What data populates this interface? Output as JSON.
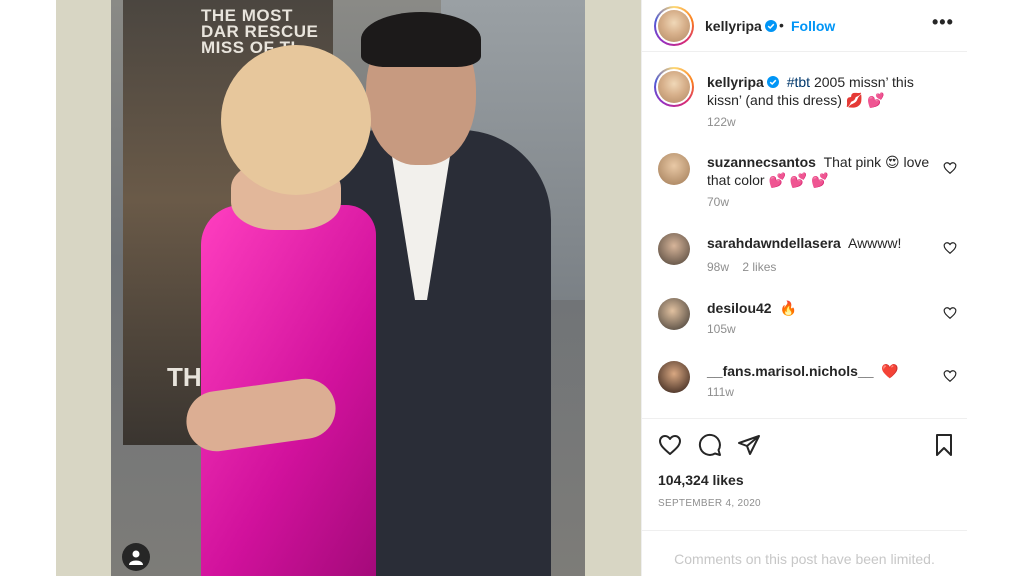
{
  "colors": {
    "accent": "#0095f6",
    "text": "#262626",
    "muted": "#8e8e8e",
    "heart": "#ed4956"
  },
  "photo": {
    "poster_text": "THE MOST DAR RESCUE MISS OF TI",
    "poster_bottom_text": "THE"
  },
  "header": {
    "username": "kellyripa",
    "separator": "•",
    "follow_label": "Follow",
    "more_icon": "more-horizontal-icon"
  },
  "caption": {
    "username": "kellyripa",
    "hashtag": "#tbt",
    "text": " 2005 missn’ this kissn’ (and this dress) 💋 💕",
    "time": "122w"
  },
  "comments": [
    {
      "username": "suzannecsantos",
      "text": "That pink 😍 love that color 💕 💕 💕",
      "time": "70w",
      "likes": ""
    },
    {
      "username": "sarahdawndellasera",
      "text": "Awwww!",
      "time": "98w",
      "likes": "2 likes"
    },
    {
      "username": "desilou42",
      "text": "🔥",
      "time": "105w",
      "likes": ""
    },
    {
      "username": "__fans.marisol.nichols__",
      "text": "❤️",
      "time": "111w",
      "likes": ""
    }
  ],
  "actions": {
    "like_icon": "heart-icon",
    "comment_icon": "comment-icon",
    "share_icon": "share-icon",
    "save_icon": "bookmark-icon"
  },
  "likes_text": "104,324 likes",
  "date_text": "SEPTEMBER 4, 2020",
  "comments_limited_text": "Comments on this post have been limited."
}
